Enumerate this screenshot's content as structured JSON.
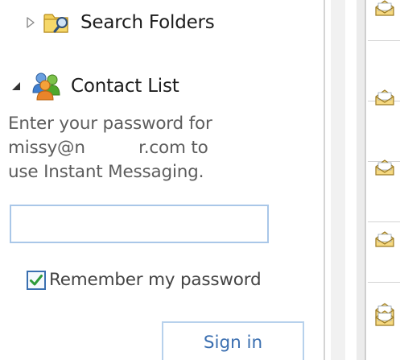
{
  "navigation": {
    "search_folders": {
      "label": "Search Folders",
      "expanded": false
    },
    "contact_list": {
      "label": "Contact List",
      "expanded": true
    }
  },
  "im_signin": {
    "prompt_lines": [
      "Enter your password for",
      "missy@n          r.com to",
      "use Instant Messaging."
    ],
    "password_value": "",
    "remember_label": "Remember my password",
    "remember_checked": true,
    "signin_label": "Sign in"
  },
  "message_list": {
    "rows": [
      {
        "icon": "read-envelope-icon"
      },
      {
        "icon": "read-envelope-icon"
      },
      {
        "icon": "read-envelope-icon"
      },
      {
        "icon": "read-envelope-icon"
      },
      {
        "icon": "read-envelope-icon"
      },
      {
        "icon": "read-envelope-icon"
      }
    ]
  },
  "colors": {
    "prompt_text": "#5d5d5d",
    "input_border": "#a9c7e8",
    "checkbox_check": "#2e9b3a",
    "signin_text": "#3b6fb0"
  }
}
